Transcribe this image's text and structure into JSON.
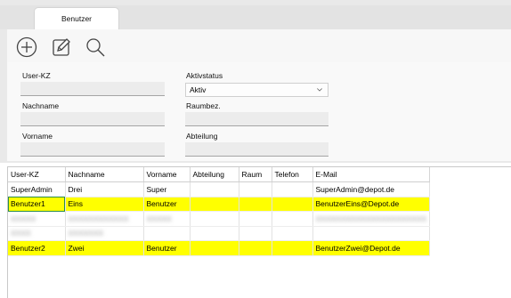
{
  "tabs": [
    {
      "label": "Benutzer"
    }
  ],
  "toolbar": {
    "add_icon": "plus-circle-icon",
    "edit_icon": "edit-icon",
    "search_icon": "search-icon"
  },
  "form": {
    "user_kz_label": "User-KZ",
    "user_kz_value": "",
    "nachname_label": "Nachname",
    "nachname_value": "",
    "vorname_label": "Vorname",
    "vorname_value": "",
    "aktivstatus_label": "Aktivstatus",
    "aktivstatus_value": "Aktiv",
    "raumbez_label": "Raumbez.",
    "raumbez_value": "",
    "abteilung_label": "Abteilung",
    "abteilung_value": ""
  },
  "table": {
    "columns": [
      "User-KZ",
      "Nachname",
      "Vorname",
      "Abteilung",
      "Raum",
      "Telefon",
      "E-Mail"
    ],
    "rows": [
      {
        "cells": [
          "SuperAdmin",
          "Drei",
          "Super",
          "",
          "",
          "",
          "SuperAdmin@depot.de"
        ],
        "highlight": false
      },
      {
        "cells": [
          "Benutzer1",
          "Eins",
          "Benutzer",
          "",
          "",
          "",
          "BenutzerEins@Depot.de"
        ],
        "highlight": true
      },
      {
        "cells": [
          "XXXXX",
          "XXXXXXXXXXXX",
          "XXXXX",
          "",
          "",
          "",
          "XXXXXXXXXXXXXXXXXXXXXX"
        ],
        "highlight": false,
        "blurred": true
      },
      {
        "cells": [
          "XXXX",
          "XXXXXXX",
          "",
          "",
          "",
          "",
          ""
        ],
        "highlight": false,
        "blurred": true
      },
      {
        "cells": [
          "Benutzer2",
          "Zwei",
          "Benutzer",
          "",
          "",
          "",
          "BenutzerZwei@Depot.de"
        ],
        "highlight": true
      }
    ]
  },
  "colors": {
    "highlight": "#ffff00",
    "selection": "#2a8a4a"
  }
}
